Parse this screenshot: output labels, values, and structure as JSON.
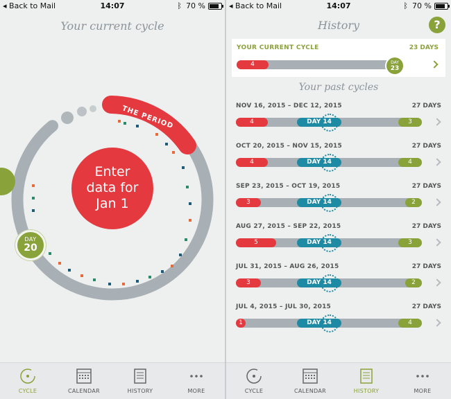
{
  "status": {
    "back_label": "Back to Mail",
    "time": "14:07",
    "battery_pct": "70 %",
    "battery_fraction": 0.7,
    "bluetooth_icon": "bluetooth-icon"
  },
  "left": {
    "title": "Your current cycle",
    "period_label": "THE PERIOD",
    "enter_line1": "Enter",
    "enter_line2": "data for",
    "enter_line3": "Jan 1",
    "day_label": "DAY",
    "day_number": "20"
  },
  "right": {
    "title": "History",
    "help_label": "?",
    "current": {
      "label": "YOUR CURRENT CYCLE",
      "days": "23 DAYS",
      "period_days": "4",
      "day_label": "DAY",
      "day_number": "23"
    },
    "past_title": "Your past cycles",
    "ovulation_label": "DAY 14",
    "cycles": [
      {
        "dates": "NOV 16, 2015 – DEC 12, 2015",
        "days": "27 DAYS",
        "period": "4",
        "end": "3"
      },
      {
        "dates": "OCT 20, 2015 – NOV 15, 2015",
        "days": "27 DAYS",
        "period": "4",
        "end": "4"
      },
      {
        "dates": "SEP 23, 2015 – OCT 19, 2015",
        "days": "27 DAYS",
        "period": "3",
        "end": "2"
      },
      {
        "dates": "AUG 27, 2015 – SEP 22, 2015",
        "days": "27 DAYS",
        "period": "5",
        "end": "3"
      },
      {
        "dates": "JUL 31, 2015 – AUG 26, 2015",
        "days": "27 DAYS",
        "period": "3",
        "end": "2"
      },
      {
        "dates": "JUL 4, 2015 – JUL 30, 2015",
        "days": "27 DAYS",
        "period": "1",
        "end": "4"
      }
    ]
  },
  "tabs": [
    {
      "label": "CYCLE",
      "icon": "cycle-icon"
    },
    {
      "label": "CALENDAR",
      "icon": "calendar-icon"
    },
    {
      "label": "HISTORY",
      "icon": "history-icon"
    },
    {
      "label": "MORE",
      "icon": "more-icon"
    }
  ],
  "colors": {
    "red": "#e4393f",
    "green": "#8aa23a",
    "teal": "#1e8aa3",
    "gray": "#a8b0b5"
  }
}
